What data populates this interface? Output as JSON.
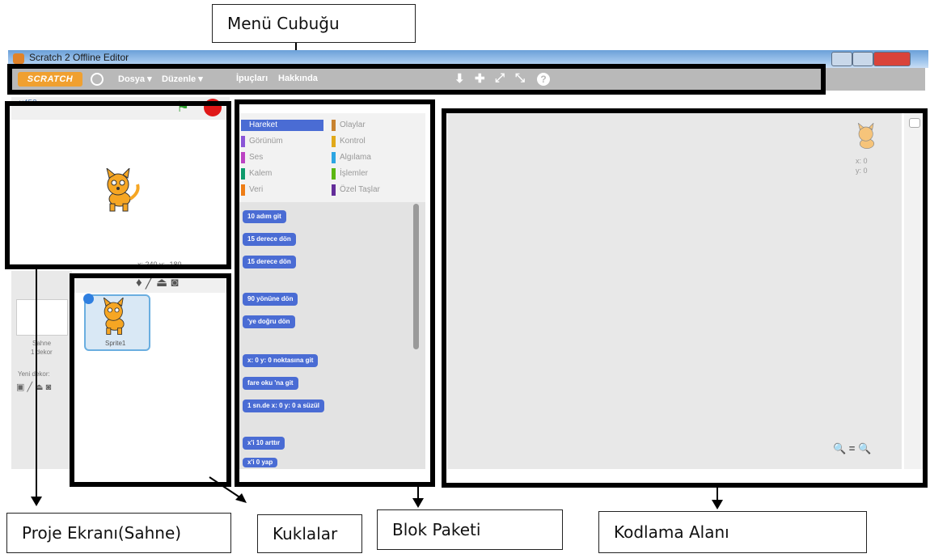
{
  "callouts": {
    "menu": "Menü Cubuğu",
    "stage": "Proje Ekranı(Sahne)",
    "sprites": "Kuklalar",
    "blocks": "Blok Paketi",
    "code": "Kodlama Alanı"
  },
  "window": {
    "title": "Scratch 2 Offline Editor"
  },
  "menubar": {
    "logo": "SCRATCH",
    "items": [
      "Dosya ▾",
      "Düzenle ▾",
      "İpuçları",
      "Hakkında"
    ],
    "tools": [
      "⬇",
      "✚",
      "⤢",
      "⤡",
      "?"
    ]
  },
  "stage": {
    "version": "v452",
    "coords": "x: 240  y: -180"
  },
  "left_panel": {
    "stage_label": "Sahne",
    "stage_sub": "1 dekor",
    "new_backdrop": "Yeni dekor:"
  },
  "sprites": {
    "sprite_name": "Sprite1"
  },
  "categories": {
    "left": [
      "Hareket",
      "Görünüm",
      "Ses",
      "Kalem",
      "Veri"
    ],
    "right": [
      "Olaylar",
      "Kontrol",
      "Algılama",
      "İşlemler",
      "Özel Taşlar"
    ]
  },
  "blocks": [
    "10 adım git",
    "15 derece dön",
    "15 derece dön",
    "90 yönüne dön",
    "'ye doğru dön",
    "x: 0 y: 0 noktasına git",
    "fare oku 'na git",
    "1 sn.de x: 0 y: 0 a süzül",
    "x'i 10 arttır",
    "x'i 0 yap"
  ],
  "code_area": {
    "sprite_x": "x: 0",
    "sprite_y": "y: 0",
    "zoom": "🔍 = 🔍"
  },
  "colors": {
    "motion": "#4a6cd4",
    "looks": "#8a55d7",
    "sound": "#bb42c3",
    "pen": "#0e9a6c",
    "data": "#ee7d16",
    "events": "#c88330",
    "control": "#e1a91a",
    "sensing": "#2ca5e2",
    "operators": "#5cb712",
    "more": "#632d99"
  }
}
